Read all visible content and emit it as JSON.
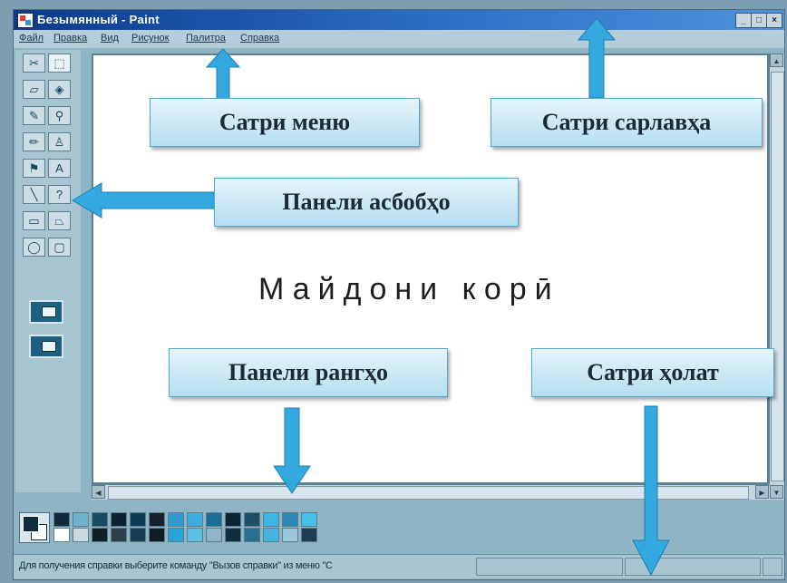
{
  "window": {
    "title": "Безымянный - Paint"
  },
  "window_buttons": {
    "minimize": "_",
    "maximize": "□",
    "close": "×"
  },
  "menu": {
    "items": [
      "Файл",
      "Правка",
      "Вид",
      "Рисунок",
      "Палитра",
      "Справка"
    ]
  },
  "toolbox": {
    "tools": [
      {
        "name": "free-select-icon",
        "glyph": "✂"
      },
      {
        "name": "rect-select-icon",
        "glyph": "⬚"
      },
      {
        "name": "eraser-icon",
        "glyph": "▱"
      },
      {
        "name": "fill-icon",
        "glyph": "◈"
      },
      {
        "name": "color-picker-icon",
        "glyph": "✎"
      },
      {
        "name": "magnifier-icon",
        "glyph": "⚲"
      },
      {
        "name": "pencil-icon",
        "glyph": "✏"
      },
      {
        "name": "brush-icon",
        "glyph": "♙"
      },
      {
        "name": "airbrush-icon",
        "glyph": "⚑"
      },
      {
        "name": "text-icon",
        "glyph": "A"
      },
      {
        "name": "line-icon",
        "glyph": "╲"
      },
      {
        "name": "curve-icon",
        "glyph": "?"
      },
      {
        "name": "rectangle-icon",
        "glyph": "▭"
      },
      {
        "name": "polygon-icon",
        "glyph": "⏢"
      },
      {
        "name": "ellipse-icon",
        "glyph": "◯"
      },
      {
        "name": "rounded-rect-icon",
        "glyph": "▢"
      }
    ]
  },
  "palette": {
    "colors_row1": [
      "#0e2a38",
      "#6fb3cf",
      "#1b4a63",
      "#0c2230",
      "#0d3a55",
      "#14202b",
      "#2f9bd0",
      "#3aaede",
      "#1a6e93",
      "#0b2433",
      "#1e4e69",
      "#3eb6e3",
      "#2c89b6",
      "#44c0ea"
    ],
    "colors_row2": [
      "#ffffff",
      "#cfd8dc",
      "#0f1f28",
      "#2c3f4a",
      "#163b52",
      "#101b24",
      "#27a3d8",
      "#5bbfe6",
      "#8fb6c7",
      "#0e2d3e",
      "#2a6f92",
      "#46b4e0",
      "#9bc7d8",
      "#1b3e54"
    ]
  },
  "status": {
    "text": "Для получения справки выберите команду \"Вызов справки\" из меню \"С"
  },
  "annotations": {
    "menu_bar": "Сатри меню",
    "title_bar": "Сатри сарлавҳа",
    "toolbox": "Панели асбобҳо",
    "workspace": "Майдони корӣ",
    "palette": "Панели рангҳо",
    "status_bar": "Сатри ҳолат"
  },
  "colors": {
    "accent": "#33a9df",
    "titlebar": "#0a3a8c"
  }
}
